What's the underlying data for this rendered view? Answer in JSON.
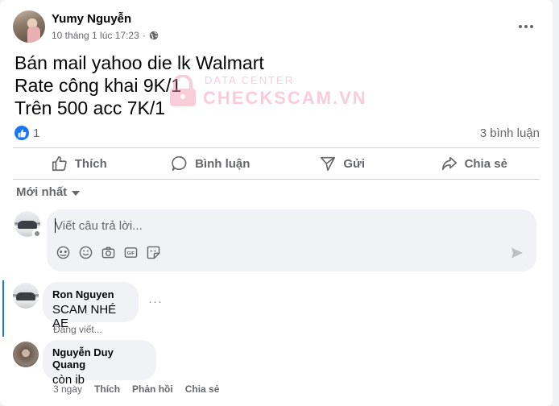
{
  "post": {
    "author": "Yumy Nguyễn",
    "timestamp": "10 tháng 1 lúc 17:23",
    "privacy_icon": "globe-icon",
    "lines": [
      "Bán mail yahoo die lk Walmart",
      "Rate công khai 9K/1",
      "Trên 500 acc 7K/1"
    ],
    "watermark": {
      "small": "DATA CENTER",
      "big": "CHECKSCAM.VN",
      "color": "#f28fae"
    }
  },
  "stats": {
    "likes": "1",
    "comments": "3 bình luận"
  },
  "actions": {
    "like": "Thích",
    "comment": "Bình luận",
    "send": "Gửi",
    "share": "Chia sẻ"
  },
  "sort": {
    "label": "Mới nhất"
  },
  "composer": {
    "placeholder": "Viết câu trả lời..."
  },
  "comments": [
    {
      "name": "Ron Nguyen",
      "text": "SCAM NHÉ AE",
      "status": "Đang viết..."
    },
    {
      "name": "Nguyễn Duy Quang",
      "text": "còn ib",
      "time": "3 ngày",
      "like": "Thích",
      "reply": "Phản hồi",
      "share": "Chia sẻ"
    }
  ],
  "colors": {
    "accent": "#1877f2",
    "secondary_text": "#65676b",
    "bubble": "#f0f2f5"
  }
}
